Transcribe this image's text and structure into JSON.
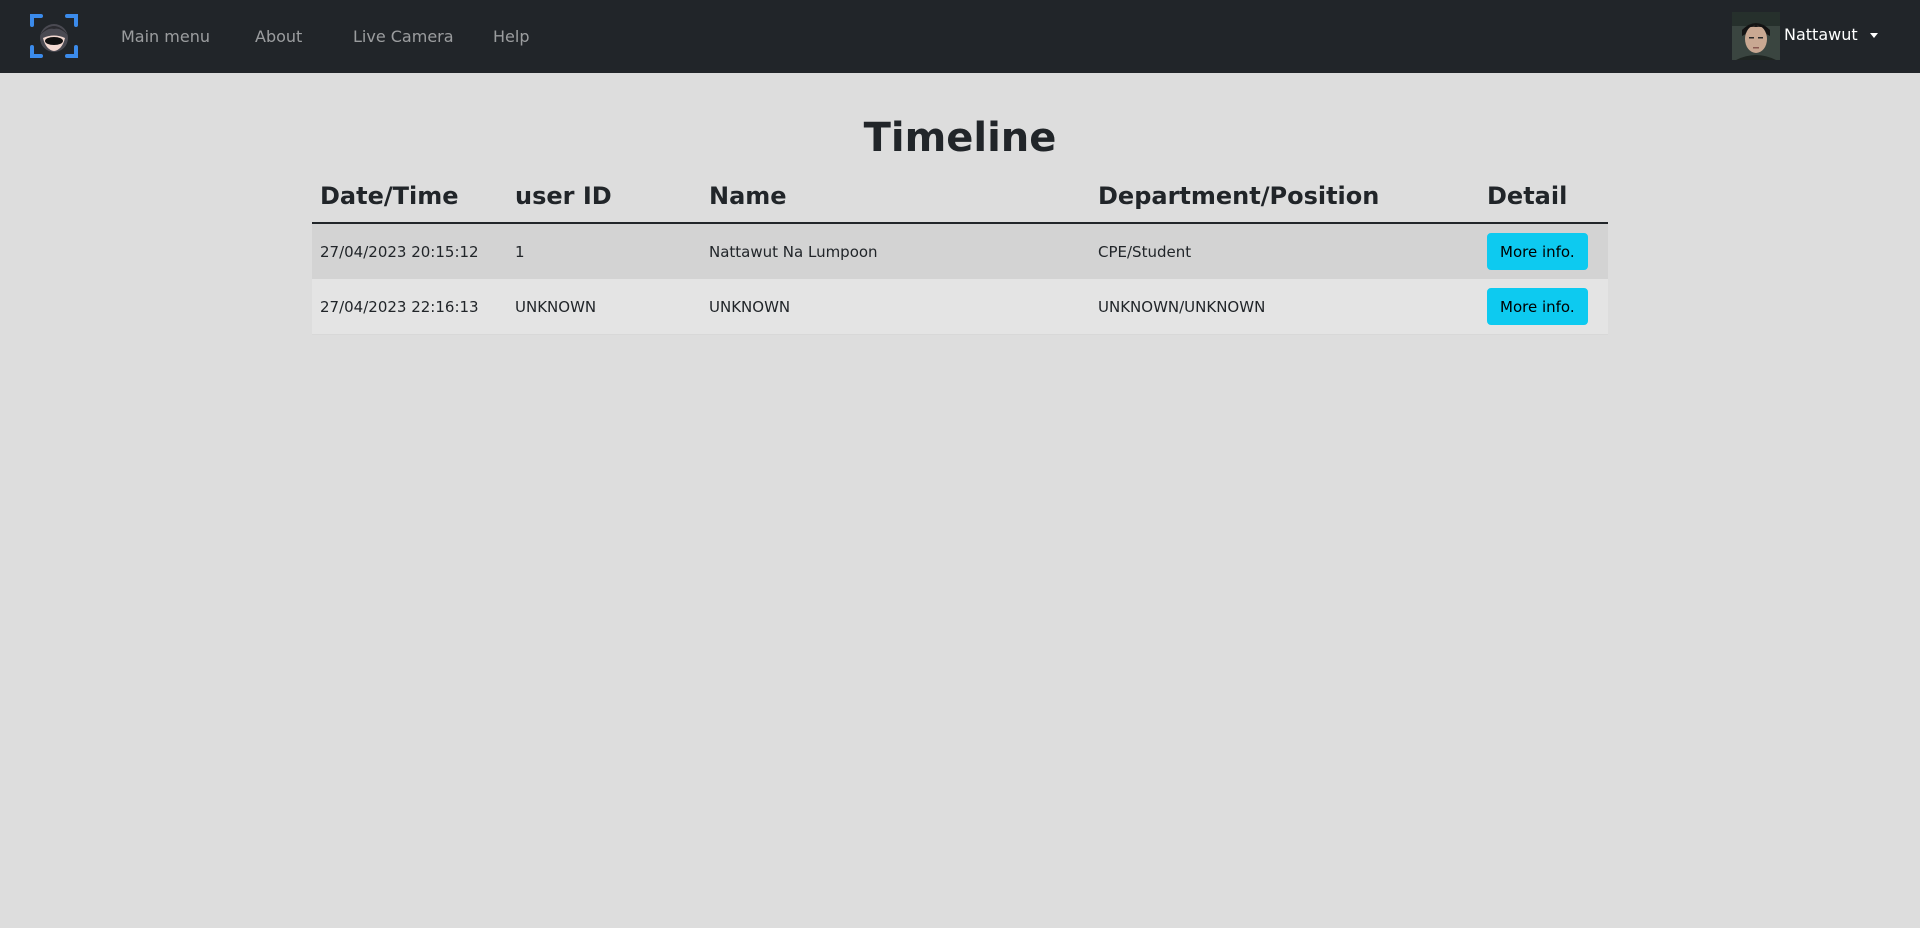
{
  "nav": {
    "logo_icon": "face-scan-logo-icon",
    "links": [
      {
        "label": "Main menu"
      },
      {
        "label": "About"
      },
      {
        "label": "Live Camera"
      },
      {
        "label": "Help"
      }
    ],
    "user": {
      "name": "Nattawut",
      "avatar_icon": "user-avatar-photo"
    }
  },
  "page": {
    "title": "Timeline"
  },
  "table": {
    "headers": [
      "Date/Time",
      "user ID",
      "Name",
      "Department/Position",
      "Detail"
    ],
    "rows": [
      {
        "datetime": "27/04/2023 20:15:12",
        "user_id": "1",
        "name": "Nattawut Na Lumpoon",
        "dept": "CPE/Student",
        "action": "More info."
      },
      {
        "datetime": "27/04/2023 22:16:13",
        "user_id": "UNKNOWN",
        "name": "UNKNOWN",
        "dept": "UNKNOWN/UNKNOWN",
        "action": "More info."
      }
    ]
  },
  "colors": {
    "navbar": "#212529",
    "background": "#dddddd",
    "button": "#0dcaf0",
    "logo_accent": "#3b8beb"
  }
}
